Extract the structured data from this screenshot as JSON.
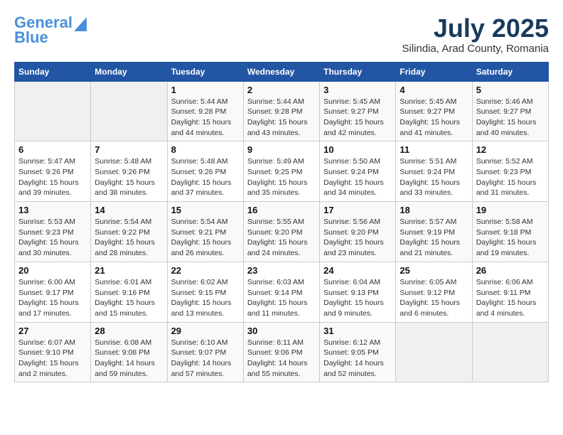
{
  "header": {
    "logo_line1": "General",
    "logo_line2": "Blue",
    "month_title": "July 2025",
    "location": "Silindia, Arad County, Romania"
  },
  "days_of_week": [
    "Sunday",
    "Monday",
    "Tuesday",
    "Wednesday",
    "Thursday",
    "Friday",
    "Saturday"
  ],
  "weeks": [
    [
      {
        "day": "",
        "empty": true
      },
      {
        "day": "",
        "empty": true
      },
      {
        "day": "1",
        "sunrise": "5:44 AM",
        "sunset": "9:28 PM",
        "daylight": "15 hours and 44 minutes."
      },
      {
        "day": "2",
        "sunrise": "5:44 AM",
        "sunset": "9:28 PM",
        "daylight": "15 hours and 43 minutes."
      },
      {
        "day": "3",
        "sunrise": "5:45 AM",
        "sunset": "9:27 PM",
        "daylight": "15 hours and 42 minutes."
      },
      {
        "day": "4",
        "sunrise": "5:45 AM",
        "sunset": "9:27 PM",
        "daylight": "15 hours and 41 minutes."
      },
      {
        "day": "5",
        "sunrise": "5:46 AM",
        "sunset": "9:27 PM",
        "daylight": "15 hours and 40 minutes."
      }
    ],
    [
      {
        "day": "6",
        "sunrise": "5:47 AM",
        "sunset": "9:26 PM",
        "daylight": "15 hours and 39 minutes."
      },
      {
        "day": "7",
        "sunrise": "5:48 AM",
        "sunset": "9:26 PM",
        "daylight": "15 hours and 38 minutes."
      },
      {
        "day": "8",
        "sunrise": "5:48 AM",
        "sunset": "9:26 PM",
        "daylight": "15 hours and 37 minutes."
      },
      {
        "day": "9",
        "sunrise": "5:49 AM",
        "sunset": "9:25 PM",
        "daylight": "15 hours and 35 minutes."
      },
      {
        "day": "10",
        "sunrise": "5:50 AM",
        "sunset": "9:24 PM",
        "daylight": "15 hours and 34 minutes."
      },
      {
        "day": "11",
        "sunrise": "5:51 AM",
        "sunset": "9:24 PM",
        "daylight": "15 hours and 33 minutes."
      },
      {
        "day": "12",
        "sunrise": "5:52 AM",
        "sunset": "9:23 PM",
        "daylight": "15 hours and 31 minutes."
      }
    ],
    [
      {
        "day": "13",
        "sunrise": "5:53 AM",
        "sunset": "9:23 PM",
        "daylight": "15 hours and 30 minutes."
      },
      {
        "day": "14",
        "sunrise": "5:54 AM",
        "sunset": "9:22 PM",
        "daylight": "15 hours and 28 minutes."
      },
      {
        "day": "15",
        "sunrise": "5:54 AM",
        "sunset": "9:21 PM",
        "daylight": "15 hours and 26 minutes."
      },
      {
        "day": "16",
        "sunrise": "5:55 AM",
        "sunset": "9:20 PM",
        "daylight": "15 hours and 24 minutes."
      },
      {
        "day": "17",
        "sunrise": "5:56 AM",
        "sunset": "9:20 PM",
        "daylight": "15 hours and 23 minutes."
      },
      {
        "day": "18",
        "sunrise": "5:57 AM",
        "sunset": "9:19 PM",
        "daylight": "15 hours and 21 minutes."
      },
      {
        "day": "19",
        "sunrise": "5:58 AM",
        "sunset": "9:18 PM",
        "daylight": "15 hours and 19 minutes."
      }
    ],
    [
      {
        "day": "20",
        "sunrise": "6:00 AM",
        "sunset": "9:17 PM",
        "daylight": "15 hours and 17 minutes."
      },
      {
        "day": "21",
        "sunrise": "6:01 AM",
        "sunset": "9:16 PM",
        "daylight": "15 hours and 15 minutes."
      },
      {
        "day": "22",
        "sunrise": "6:02 AM",
        "sunset": "9:15 PM",
        "daylight": "15 hours and 13 minutes."
      },
      {
        "day": "23",
        "sunrise": "6:03 AM",
        "sunset": "9:14 PM",
        "daylight": "15 hours and 11 minutes."
      },
      {
        "day": "24",
        "sunrise": "6:04 AM",
        "sunset": "9:13 PM",
        "daylight": "15 hours and 9 minutes."
      },
      {
        "day": "25",
        "sunrise": "6:05 AM",
        "sunset": "9:12 PM",
        "daylight": "15 hours and 6 minutes."
      },
      {
        "day": "26",
        "sunrise": "6:06 AM",
        "sunset": "9:11 PM",
        "daylight": "15 hours and 4 minutes."
      }
    ],
    [
      {
        "day": "27",
        "sunrise": "6:07 AM",
        "sunset": "9:10 PM",
        "daylight": "15 hours and 2 minutes."
      },
      {
        "day": "28",
        "sunrise": "6:08 AM",
        "sunset": "9:08 PM",
        "daylight": "14 hours and 59 minutes."
      },
      {
        "day": "29",
        "sunrise": "6:10 AM",
        "sunset": "9:07 PM",
        "daylight": "14 hours and 57 minutes."
      },
      {
        "day": "30",
        "sunrise": "6:11 AM",
        "sunset": "9:06 PM",
        "daylight": "14 hours and 55 minutes."
      },
      {
        "day": "31",
        "sunrise": "6:12 AM",
        "sunset": "9:05 PM",
        "daylight": "14 hours and 52 minutes."
      },
      {
        "day": "",
        "empty": true
      },
      {
        "day": "",
        "empty": true
      }
    ]
  ],
  "labels": {
    "sunrise_label": "Sunrise:",
    "sunset_label": "Sunset:",
    "daylight_label": "Daylight: "
  }
}
